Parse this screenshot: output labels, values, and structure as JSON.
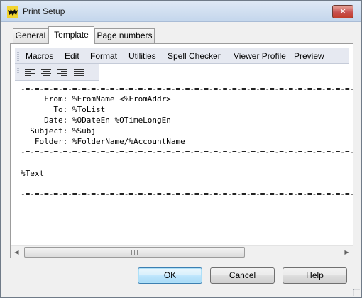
{
  "window": {
    "title": "Print Setup",
    "close_glyph": "✕"
  },
  "tabs": [
    {
      "label": "General",
      "active": false
    },
    {
      "label": "Template",
      "active": true
    },
    {
      "label": "Page numbers",
      "active": false
    }
  ],
  "menu": {
    "items": [
      "Macros",
      "Edit",
      "Format",
      "Utilities",
      "Spell Checker",
      "Viewer Profile",
      "Preview"
    ]
  },
  "toolbar": {
    "align_icons": [
      "align-left-icon",
      "align-center-icon",
      "align-right-icon",
      "align-justify-icon"
    ]
  },
  "template": {
    "lines": [
      "-=-=-=-=-=-=-=-=-=-=-=-=-=-=-=-=-=-=-=-=-=-=-=-=-=-=-=-=-=-=-=-=-=-=-=-=-=-",
      "     From: %FromName <%FromAddr>",
      "       To: %ToList",
      "     Date: %ODateEn %OTimeLongEn",
      "  Subject: %Subj",
      "   Folder: %FolderName/%AccountName",
      "-=-=-=-=-=-=-=-=-=-=-=-=-=-=-=-=-=-=-=-=-=-=-=-=-=-=-=-=-=-=-=-=-=-=-=-=-=-",
      "",
      "%Text",
      "",
      "-=-=-=-=-=-=-=-=-=-=-=-=-=-=-=-=-=-=-=-=-=-=-=-=-=-=-=-=-=-=-=-=-=-=-=-=-=-"
    ]
  },
  "scrollbar": {
    "left_arrow": "◀",
    "right_arrow": "▶"
  },
  "buttons": {
    "ok": "OK",
    "cancel": "Cancel",
    "help": "Help"
  },
  "colors": {
    "menubar_bg": "#e6e9f1",
    "default_button_border": "#3c7fb1",
    "close_button": "#c75050"
  }
}
